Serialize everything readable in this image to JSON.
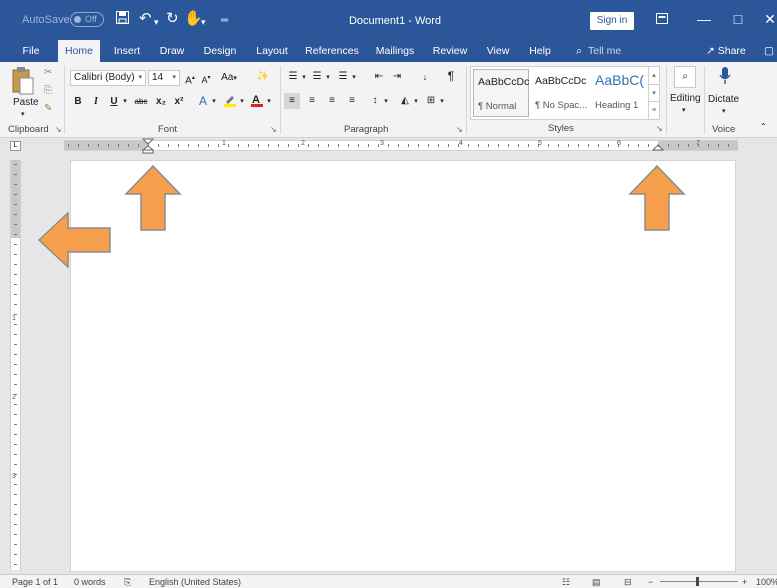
{
  "titlebar": {
    "autosave_label": "AutoSave",
    "autosave_state": "Off",
    "save_icon": "save-icon",
    "undo_icon": "undo-icon",
    "redo_icon": "redo-icon",
    "touch_icon": "touch-mode-icon",
    "document_title": "Document1 - Word",
    "signin_label": "Sign in",
    "colors": {
      "bar": "#2b579a",
      "text": "#ffffff"
    }
  },
  "tabs": {
    "items": [
      "File",
      "Home",
      "Insert",
      "Draw",
      "Design",
      "Layout",
      "References",
      "Mailings",
      "Review",
      "View",
      "Help"
    ],
    "active": "Home",
    "tell_me": "Tell me",
    "share": "Share"
  },
  "ribbon": {
    "clipboard": {
      "paste_label": "Paste",
      "group_label": "Clipboard"
    },
    "font": {
      "font_name": "Calibri (Body)",
      "font_size": "14",
      "change_case": "Aa",
      "group_label": "Font",
      "buttons": [
        "B",
        "I",
        "U",
        "abc",
        "x₂",
        "x²"
      ]
    },
    "paragraph": {
      "group_label": "Paragraph"
    },
    "styles": {
      "items": [
        {
          "sample": "AaBbCcDc",
          "name": "¶ Normal"
        },
        {
          "sample": "AaBbCcDc",
          "name": "¶ No Spac..."
        },
        {
          "sample": "AaBbC(",
          "name": "Heading 1"
        }
      ],
      "group_label": "Styles"
    },
    "editing": {
      "label": "Editing"
    },
    "voice": {
      "dictate_label": "Dictate",
      "group_label": "Voice"
    }
  },
  "ruler": {
    "numbers": [
      "1",
      "2",
      "3",
      "4",
      "5",
      "6",
      "7"
    ],
    "vertical_numbers": [
      "1",
      "2",
      "3"
    ]
  },
  "status": {
    "page": "Page 1 of 1",
    "words": "0 words",
    "language": "English (United States)",
    "zoom": "100%"
  },
  "annotations": {
    "arrow_color": "#f6a04d",
    "arrow_outline": "#8c8c8c"
  }
}
